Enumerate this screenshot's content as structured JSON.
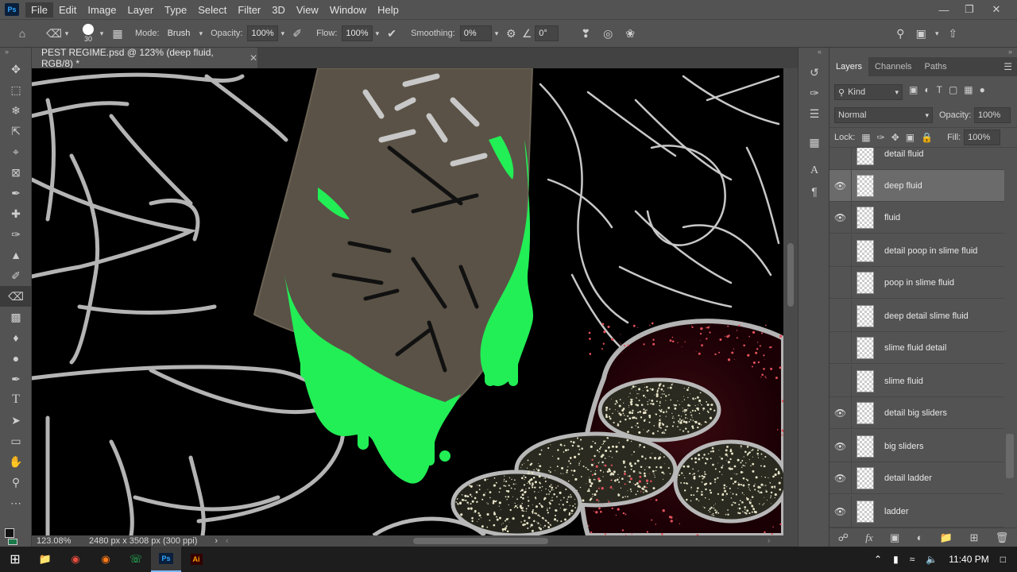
{
  "app": {
    "logo": "Ps"
  },
  "menu": [
    "File",
    "Edit",
    "Image",
    "Layer",
    "Type",
    "Select",
    "Filter",
    "3D",
    "View",
    "Window",
    "Help"
  ],
  "options": {
    "brush_size": "30",
    "mode_label": "Mode:",
    "mode_value": "Brush",
    "opacity_label": "Opacity:",
    "opacity_value": "100%",
    "flow_label": "Flow:",
    "flow_value": "100%",
    "smoothing_label": "Smoothing:",
    "smoothing_value": "0%",
    "angle_value": "0°"
  },
  "document": {
    "tab_title": "PEST REGIME.psd @ 123% (deep fluid, RGB/8) *",
    "zoom": "123.08%",
    "size_info": "2480 px x 3508 px (300 ppi)"
  },
  "layers_panel": {
    "tabs": [
      "Layers",
      "Channels",
      "Paths"
    ],
    "filter_kind": "Kind",
    "blend_mode": "Normal",
    "opacity_label": "Opacity:",
    "opacity_value": "100%",
    "lock_label": "Lock:",
    "fill_label": "Fill:",
    "fill_value": "100%",
    "layers": [
      {
        "name": "detail fluid",
        "visible": false
      },
      {
        "name": "deep fluid",
        "visible": true,
        "selected": true
      },
      {
        "name": "fluid",
        "visible": true
      },
      {
        "name": "detail poop in slime fluid",
        "visible": false
      },
      {
        "name": "poop in slime fluid",
        "visible": false
      },
      {
        "name": "deep detail slime fluid",
        "visible": false
      },
      {
        "name": "slime fluid detail",
        "visible": false
      },
      {
        "name": "slime fluid",
        "visible": false
      },
      {
        "name": "detail big sliders",
        "visible": true
      },
      {
        "name": "big sliders",
        "visible": true
      },
      {
        "name": "detail ladder",
        "visible": true
      },
      {
        "name": "ladder",
        "visible": true
      }
    ]
  },
  "taskbar": {
    "time": "11:40 PM"
  },
  "colors": {
    "slime_green": "#22ee55",
    "spatter_red": "#e0505a",
    "speckle_cream": "#e8e4c8",
    "outline_gray": "#b0b0b0"
  }
}
